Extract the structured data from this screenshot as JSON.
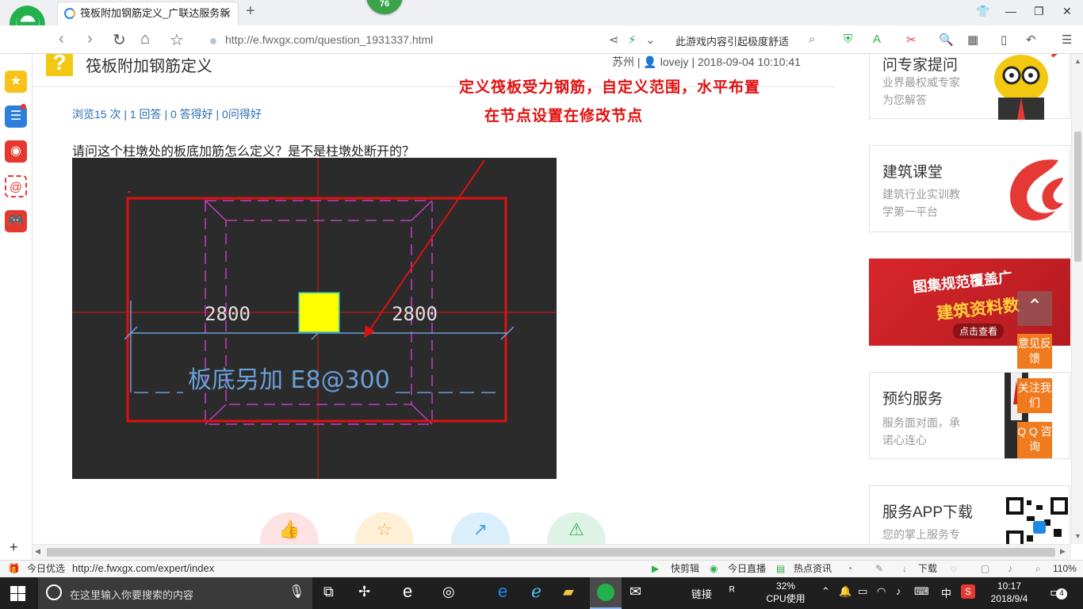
{
  "browser": {
    "tab_title": "筏板附加钢筋定义_广联达服务新",
    "notification_count": "76",
    "url": "http://e.fwxgx.com/question_1931337.html",
    "address_slogan": "此游戏内容引起极度舒适"
  },
  "question": {
    "title": "筏板附加钢筋定义",
    "city": "苏州",
    "author": "lovejy",
    "datetime": "2018-09-04 10:10:41",
    "stats": "浏览15 次 | 1 回答 | 0 答得好 | 0问得好",
    "body": "请问这个柱墩处的板底加筋怎么定义？是不是柱墩处断开的？"
  },
  "annotation": {
    "line1": "定义筏板受力钢筋，自定义范围，水平布置",
    "line2": "在节点设置在修改节点"
  },
  "cad": {
    "dim_left": "2800",
    "dim_right": "2800",
    "rebar_label": "板底另加 E8@300"
  },
  "sidebar_right": {
    "card1_title": "问专家提问",
    "card1_sub1": "业界最权威专家",
    "card1_sub2": "为您解答",
    "card2_title": "建筑课堂",
    "card2_sub1": "建筑行业实训教",
    "card2_sub2": "学第一平台",
    "banner_line1": "图集规范覆盖广",
    "banner_line2": "建筑资料数",
    "banner_cta": "点击查看",
    "card3_title": "预约服务",
    "card3_sub1": "服务面对面，承",
    "card3_sub2": "诺心连心",
    "card4_title": "服务APP下载",
    "card4_sub": "您的掌上服务专"
  },
  "float_buttons": {
    "feedback": "意见反馈",
    "follow": "关注我们",
    "qq": "Q Q 咨询"
  },
  "statusbar": {
    "today": "今日优选",
    "hover_url": "http://e.fwxgx.com/expert/index",
    "items": [
      "快剪辑",
      "今日直播",
      "热点资讯",
      "下载"
    ],
    "zoom": "110%"
  },
  "taskbar": {
    "search_placeholder": "在这里输入你要搜索的内容",
    "link_label": "链接",
    "cpu_percent": "32%",
    "cpu_label": "CPU使用",
    "ime": "中",
    "time": "10:17",
    "date": "2018/9/4",
    "notifications": "4"
  }
}
